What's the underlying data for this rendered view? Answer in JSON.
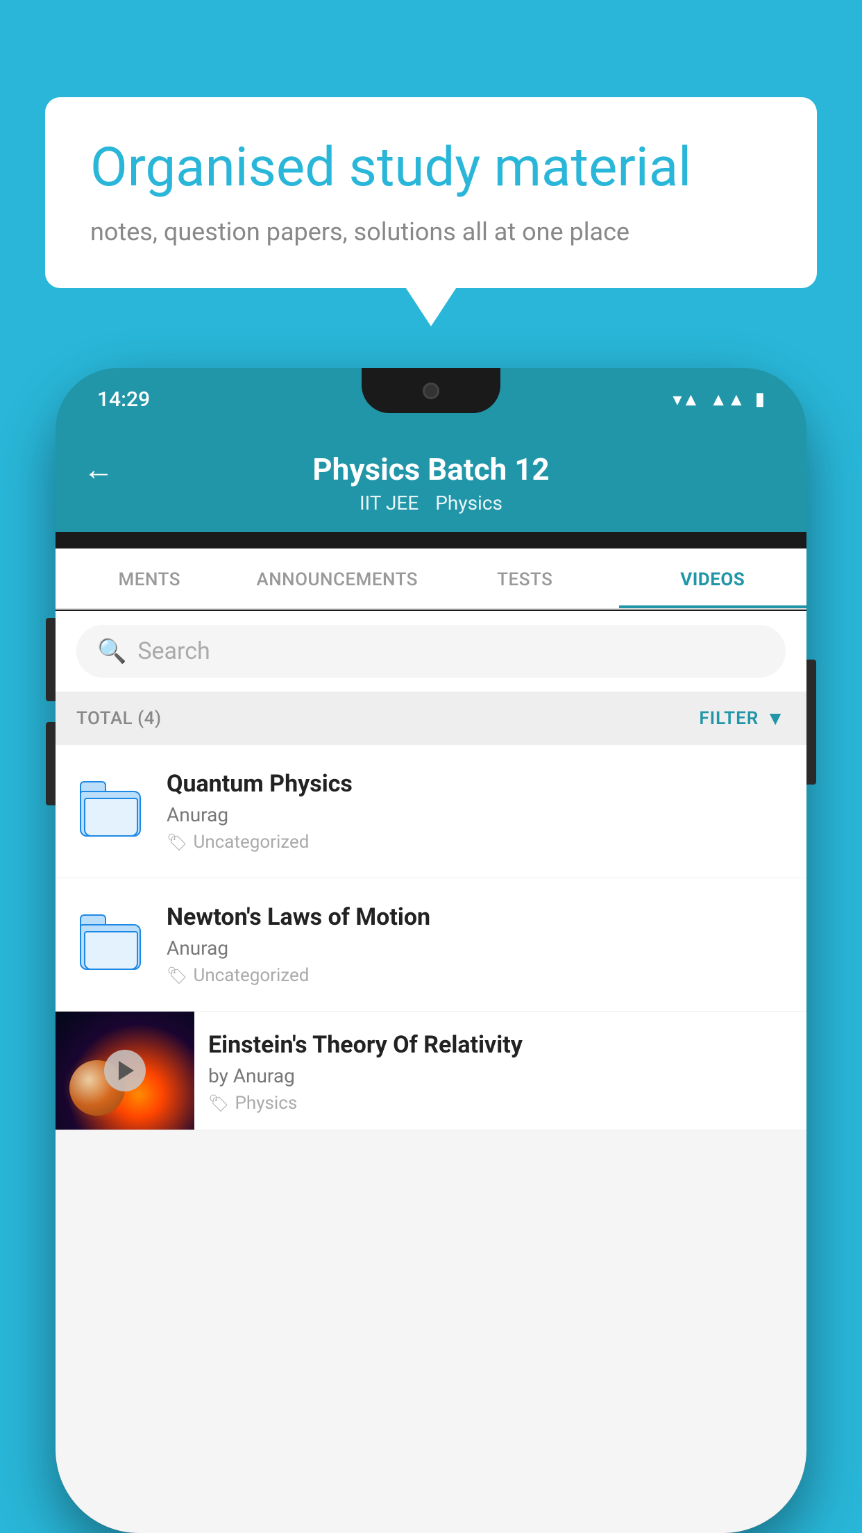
{
  "background": {
    "color": "#29b6d8"
  },
  "bubble": {
    "title": "Organised study material",
    "subtitle": "notes, question papers, solutions all at one place"
  },
  "phone": {
    "status_bar": {
      "time": "14:29"
    },
    "header": {
      "title": "Physics Batch 12",
      "tag1": "IIT JEE",
      "tag2": "Physics",
      "back_label": "←"
    },
    "tabs": [
      {
        "label": "MENTS",
        "active": false
      },
      {
        "label": "ANNOUNCEMENTS",
        "active": false
      },
      {
        "label": "TESTS",
        "active": false
      },
      {
        "label": "VIDEOS",
        "active": true
      }
    ],
    "search": {
      "placeholder": "Search"
    },
    "filter_bar": {
      "total": "TOTAL (4)",
      "filter_label": "FILTER"
    },
    "videos": [
      {
        "title": "Quantum Physics",
        "author": "Anurag",
        "category": "Uncategorized",
        "has_thumbnail": false
      },
      {
        "title": "Newton's Laws of Motion",
        "author": "Anurag",
        "category": "Uncategorized",
        "has_thumbnail": false
      },
      {
        "title": "Einstein's Theory Of Relativity",
        "author": "by Anurag",
        "category": "Physics",
        "has_thumbnail": true
      }
    ]
  }
}
